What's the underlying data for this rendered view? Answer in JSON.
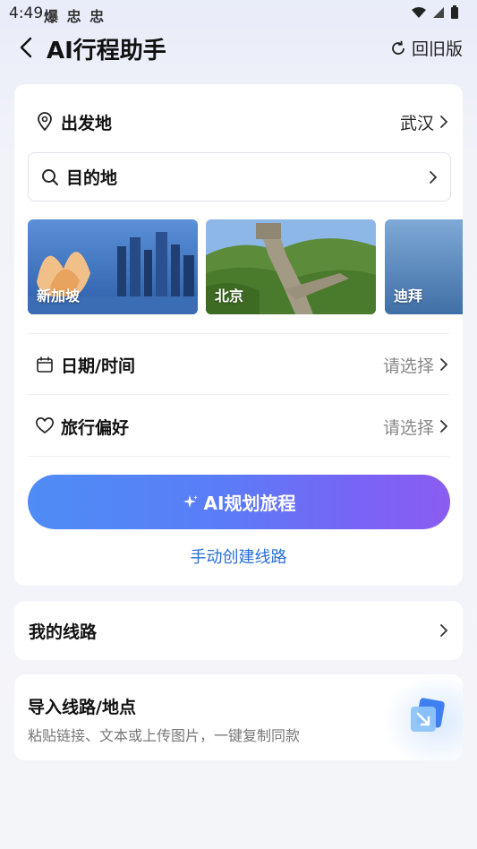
{
  "status_bar": {
    "time": "4:49",
    "notif_icons": "爆 忠 忠"
  },
  "header": {
    "title": "AI行程助手",
    "revert_label": "回旧版"
  },
  "form": {
    "departure_label": "出发地",
    "departure_value": "武汉",
    "destination_label": "目的地",
    "cities": [
      {
        "name": "新加坡"
      },
      {
        "name": "北京"
      },
      {
        "name": "迪拜"
      }
    ],
    "date_label": "日期/时间",
    "date_value": "请选择",
    "pref_label": "旅行偏好",
    "pref_value": "请选择",
    "ai_button": "AI规划旅程",
    "manual_link": "手动创建线路"
  },
  "my_routes": {
    "label": "我的线路"
  },
  "import": {
    "title": "导入线路/地点",
    "desc": "粘贴链接、文本或上传图片，一键复制同款"
  },
  "colors": {
    "accent_blue": "#2a6fd6",
    "button_start": "#4f8cf5",
    "button_end": "#8a5cf0"
  }
}
